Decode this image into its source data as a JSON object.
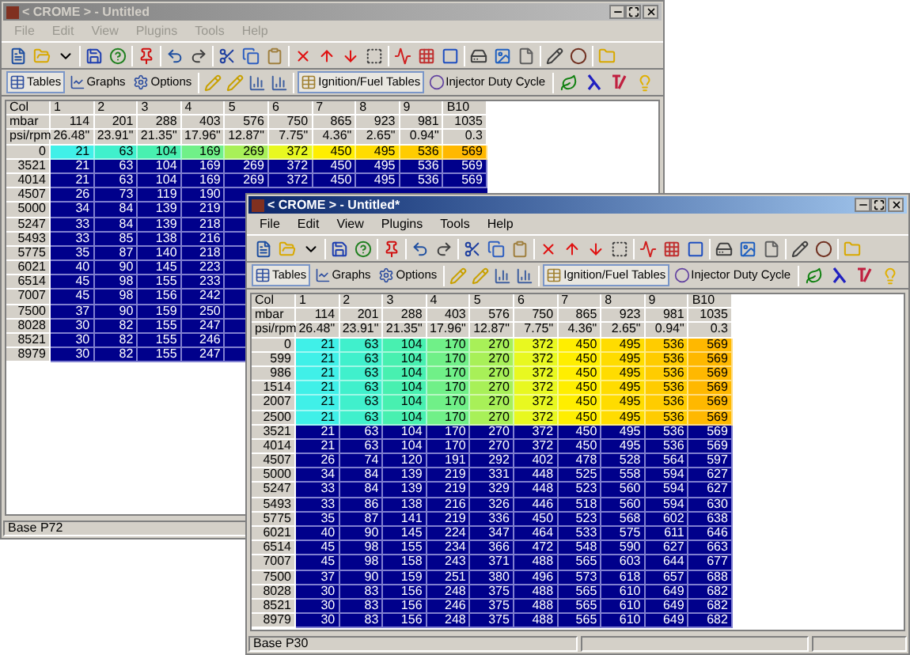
{
  "windows": [
    {
      "title": "< CROME > - Untitled",
      "active": false,
      "menu": [
        "File",
        "Edit",
        "View",
        "Plugins",
        "Tools",
        "Help"
      ],
      "view_tabs": [
        {
          "label": "Tables",
          "selected": true
        },
        {
          "label": "Graphs",
          "selected": false
        },
        {
          "label": "Options",
          "selected": false
        }
      ],
      "table_tabs": [
        {
          "label": "Ignition/Fuel Tables",
          "selected": true
        },
        {
          "label": "Injector Duty Cycle",
          "selected": false
        }
      ],
      "table": {
        "corner": "Col",
        "columns": [
          {
            "label": "1",
            "color": "#40f0e8"
          },
          {
            "label": "2",
            "color": "#40f0cc"
          },
          {
            "label": "3",
            "color": "#48f0b0"
          },
          {
            "label": "4",
            "color": "#70f088"
          },
          {
            "label": "5",
            "color": "#a8f058"
          },
          {
            "label": "6",
            "color": "#e8f820"
          },
          {
            "label": "7",
            "color": "#ffee00"
          },
          {
            "label": "8",
            "color": "#ffdc00"
          },
          {
            "label": "9",
            "color": "#ffcc00"
          },
          {
            "label": "B10",
            "color": "#ffb800"
          }
        ],
        "header_rows": [
          {
            "label": "mbar",
            "values": [
              "114",
              "201",
              "288",
              "403",
              "576",
              "750",
              "865",
              "923",
              "981",
              "1035"
            ]
          },
          {
            "label": "psi/rpm",
            "values": [
              "26.48\"",
              "23.91\"",
              "21.35\"",
              "17.96\"",
              "12.87\"",
              "7.75\"",
              "4.36\"",
              "2.65\"",
              "0.94\"",
              "0.3"
            ]
          }
        ],
        "rows": [
          {
            "label": "0",
            "selected": true,
            "values": [
              "21",
              "63",
              "104",
              "169",
              "269",
              "372",
              "450",
              "495",
              "536",
              "569"
            ]
          },
          {
            "label": "3521",
            "selected": false,
            "values": [
              "21",
              "63",
              "104",
              "169",
              "269",
              "372",
              "450",
              "495",
              "536",
              "569"
            ]
          },
          {
            "label": "4014",
            "selected": false,
            "values": [
              "21",
              "63",
              "104",
              "169",
              "269",
              "372",
              "450",
              "495",
              "536",
              "569"
            ]
          },
          {
            "label": "4507",
            "selected": false,
            "values": [
              "26",
              "73",
              "119",
              "190"
            ]
          },
          {
            "label": "5000",
            "selected": false,
            "values": [
              "34",
              "84",
              "139",
              "219"
            ]
          },
          {
            "label": "5247",
            "selected": false,
            "values": [
              "33",
              "84",
              "139",
              "218"
            ]
          },
          {
            "label": "5493",
            "selected": false,
            "values": [
              "33",
              "85",
              "138",
              "216"
            ]
          },
          {
            "label": "5775",
            "selected": false,
            "values": [
              "35",
              "87",
              "140",
              "218"
            ]
          },
          {
            "label": "6021",
            "selected": false,
            "values": [
              "40",
              "90",
              "145",
              "223"
            ]
          },
          {
            "label": "6514",
            "selected": false,
            "values": [
              "45",
              "98",
              "155",
              "233"
            ]
          },
          {
            "label": "7007",
            "selected": false,
            "values": [
              "45",
              "98",
              "156",
              "242"
            ]
          },
          {
            "label": "7500",
            "selected": false,
            "values": [
              "37",
              "90",
              "159",
              "250"
            ]
          },
          {
            "label": "8028",
            "selected": false,
            "values": [
              "30",
              "82",
              "155",
              "247"
            ]
          },
          {
            "label": "8521",
            "selected": false,
            "values": [
              "30",
              "82",
              "155",
              "246"
            ]
          },
          {
            "label": "8979",
            "selected": false,
            "values": [
              "30",
              "82",
              "155",
              "247"
            ]
          }
        ]
      },
      "status_bar": "Base P72"
    },
    {
      "title": "< CROME > - Untitled*",
      "active": true,
      "menu": [
        "File",
        "Edit",
        "View",
        "Plugins",
        "Tools",
        "Help"
      ],
      "view_tabs": [
        {
          "label": "Tables",
          "selected": true
        },
        {
          "label": "Graphs",
          "selected": false
        },
        {
          "label": "Options",
          "selected": false
        }
      ],
      "table_tabs": [
        {
          "label": "Ignition/Fuel Tables",
          "selected": true
        },
        {
          "label": "Injector Duty Cycle",
          "selected": false
        }
      ],
      "table": {
        "corner": "Col",
        "columns": [
          {
            "label": "1",
            "color": "#40f0e8"
          },
          {
            "label": "2",
            "color": "#40f0cc"
          },
          {
            "label": "3",
            "color": "#48f0b0"
          },
          {
            "label": "4",
            "color": "#70f088"
          },
          {
            "label": "5",
            "color": "#a8f058"
          },
          {
            "label": "6",
            "color": "#e8f820"
          },
          {
            "label": "7",
            "color": "#ffee00"
          },
          {
            "label": "8",
            "color": "#ffdc00"
          },
          {
            "label": "9",
            "color": "#ffcc00"
          },
          {
            "label": "B10",
            "color": "#ffb800"
          }
        ],
        "header_rows": [
          {
            "label": "mbar",
            "values": [
              "114",
              "201",
              "288",
              "403",
              "576",
              "750",
              "865",
              "923",
              "981",
              "1035"
            ]
          },
          {
            "label": "psi/rpm",
            "values": [
              "26.48\"",
              "23.91\"",
              "21.35\"",
              "17.96\"",
              "12.87\"",
              "7.75\"",
              "4.36\"",
              "2.65\"",
              "0.94\"",
              "0.3"
            ]
          }
        ],
        "rows": [
          {
            "label": "0",
            "selected": true,
            "values": [
              "21",
              "63",
              "104",
              "170",
              "270",
              "372",
              "450",
              "495",
              "536",
              "569"
            ]
          },
          {
            "label": "599",
            "selected": true,
            "values": [
              "21",
              "63",
              "104",
              "170",
              "270",
              "372",
              "450",
              "495",
              "536",
              "569"
            ]
          },
          {
            "label": "986",
            "selected": true,
            "values": [
              "21",
              "63",
              "104",
              "170",
              "270",
              "372",
              "450",
              "495",
              "536",
              "569"
            ]
          },
          {
            "label": "1514",
            "selected": true,
            "values": [
              "21",
              "63",
              "104",
              "170",
              "270",
              "372",
              "450",
              "495",
              "536",
              "569"
            ]
          },
          {
            "label": "2007",
            "selected": true,
            "values": [
              "21",
              "63",
              "104",
              "170",
              "270",
              "372",
              "450",
              "495",
              "536",
              "569"
            ]
          },
          {
            "label": "2500",
            "selected": true,
            "values": [
              "21",
              "63",
              "104",
              "170",
              "270",
              "372",
              "450",
              "495",
              "536",
              "569"
            ]
          },
          {
            "label": "3521",
            "selected": false,
            "values": [
              "21",
              "63",
              "104",
              "170",
              "270",
              "372",
              "450",
              "495",
              "536",
              "569"
            ]
          },
          {
            "label": "4014",
            "selected": false,
            "values": [
              "21",
              "63",
              "104",
              "170",
              "270",
              "372",
              "450",
              "495",
              "536",
              "569"
            ]
          },
          {
            "label": "4507",
            "selected": false,
            "values": [
              "26",
              "74",
              "120",
              "191",
              "292",
              "402",
              "478",
              "528",
              "564",
              "597"
            ]
          },
          {
            "label": "5000",
            "selected": false,
            "values": [
              "34",
              "84",
              "139",
              "219",
              "331",
              "448",
              "525",
              "558",
              "594",
              "627"
            ]
          },
          {
            "label": "5247",
            "selected": false,
            "values": [
              "33",
              "84",
              "139",
              "219",
              "329",
              "448",
              "523",
              "560",
              "594",
              "627"
            ]
          },
          {
            "label": "5493",
            "selected": false,
            "values": [
              "33",
              "86",
              "138",
              "216",
              "326",
              "446",
              "518",
              "560",
              "594",
              "630"
            ]
          },
          {
            "label": "5775",
            "selected": false,
            "values": [
              "35",
              "87",
              "141",
              "219",
              "336",
              "450",
              "523",
              "568",
              "602",
              "638"
            ]
          },
          {
            "label": "6021",
            "selected": false,
            "values": [
              "40",
              "90",
              "145",
              "224",
              "347",
              "464",
              "533",
              "575",
              "611",
              "646"
            ]
          },
          {
            "label": "6514",
            "selected": false,
            "values": [
              "45",
              "98",
              "155",
              "234",
              "366",
              "472",
              "548",
              "590",
              "627",
              "663"
            ]
          },
          {
            "label": "7007",
            "selected": false,
            "values": [
              "45",
              "98",
              "158",
              "243",
              "371",
              "488",
              "565",
              "603",
              "644",
              "677"
            ]
          },
          {
            "label": "7500",
            "selected": false,
            "values": [
              "37",
              "90",
              "159",
              "251",
              "380",
              "496",
              "573",
              "618",
              "657",
              "688"
            ]
          },
          {
            "label": "8028",
            "selected": false,
            "values": [
              "30",
              "83",
              "156",
              "248",
              "375",
              "488",
              "565",
              "610",
              "649",
              "682"
            ]
          },
          {
            "label": "8521",
            "selected": false,
            "values": [
              "30",
              "83",
              "156",
              "246",
              "375",
              "488",
              "565",
              "610",
              "649",
              "682"
            ]
          },
          {
            "label": "8979",
            "selected": false,
            "values": [
              "30",
              "83",
              "156",
              "248",
              "375",
              "488",
              "565",
              "610",
              "649",
              "682"
            ]
          }
        ]
      },
      "status_bar": "Base P30"
    }
  ]
}
